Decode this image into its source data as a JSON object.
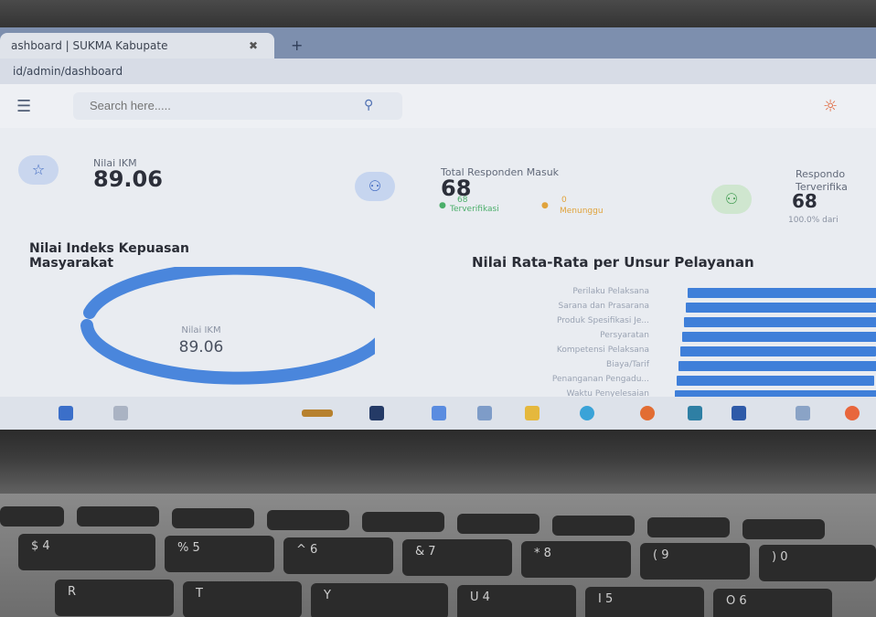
{
  "browser": {
    "tab_title": "ashboard | SUKMA Kabupate",
    "tab_close": "✖",
    "new_tab": "+",
    "url": "id/admin/dashboard"
  },
  "topbar": {
    "search_placeholder": "Search here.....",
    "search_icon": "search-icon",
    "theme_icon": "sun-icon"
  },
  "stats": {
    "ikm": {
      "label": "Nilai IKM",
      "value": "89.06",
      "icon": "star-icon"
    },
    "total": {
      "label": "Total Responden Masuk",
      "value": "68",
      "verified_count": "68",
      "verified_label": "Terverifikasi",
      "waiting_count": "0",
      "waiting_label": "Menunggu",
      "icon": "user-plus-icon"
    },
    "verified": {
      "label_line1": "Respondo",
      "label_line2": "Terverifika",
      "value": "68",
      "note": "100.0% dari",
      "icon": "user-check-icon"
    }
  },
  "ikm_panel": {
    "title_line1": "Nilai Indeks Kepuasan",
    "title_line2": "Masyarakat",
    "center_label": "Nilai IKM",
    "center_value": "89.06"
  },
  "unsur_panel": {
    "title": "Nilai Rata-Rata per Unsur Pelayanan",
    "rows": [
      {
        "label": "Perilaku Pelaksana"
      },
      {
        "label": "Sarana dan Prasarana"
      },
      {
        "label": "Produk Spesifikasi Je..."
      },
      {
        "label": "Persyaratan"
      },
      {
        "label": "Kompetensi Pelaksana"
      },
      {
        "label": "Biaya/Tarif"
      },
      {
        "label": "Penanganan Pengadu..."
      },
      {
        "label": "Waktu Penyelesaian"
      },
      {
        "label": ""
      }
    ]
  },
  "colors": {
    "accent": "#3f7fd9",
    "donut": "#4a86dc"
  }
}
